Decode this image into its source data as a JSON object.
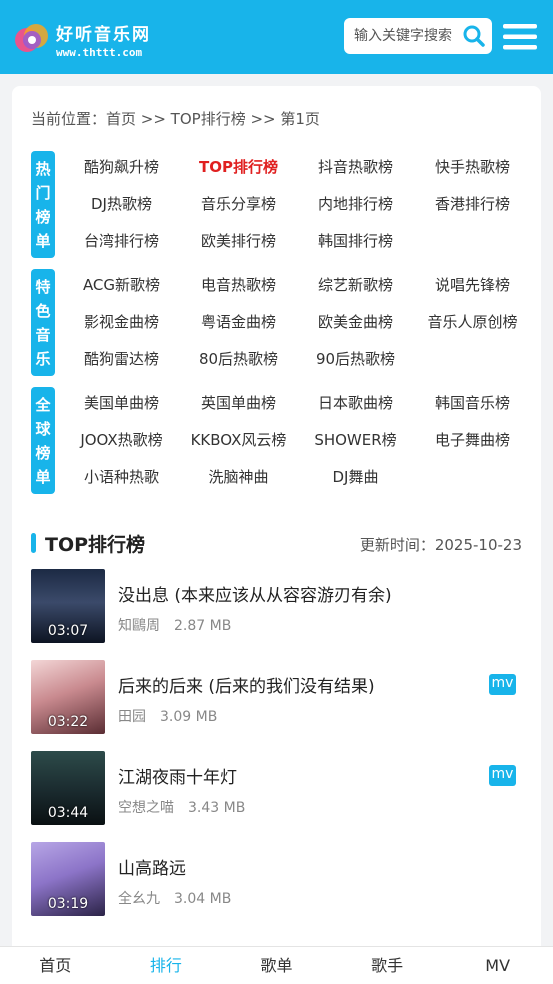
{
  "header": {
    "site_name": "好听音乐网",
    "site_url": "www.thttt.com",
    "search_placeholder": "输入关键字搜索",
    "accent_color": "#18b4ea"
  },
  "breadcrumb": "当前位置：首页 >> TOP排行榜 >> 第1页",
  "categories": [
    {
      "label": "热门榜单",
      "items": [
        "酷狗飙升榜",
        "TOP排行榜",
        "抖音热歌榜",
        "快手热歌榜",
        "DJ热歌榜",
        "音乐分享榜",
        "内地排行榜",
        "香港排行榜",
        "台湾排行榜",
        "欧美排行榜",
        "韩国排行榜"
      ]
    },
    {
      "label": "特色音乐",
      "items": [
        "ACG新歌榜",
        "电音热歌榜",
        "综艺新歌榜",
        "说唱先锋榜",
        "影视金曲榜",
        "粤语金曲榜",
        "欧美金曲榜",
        "音乐人原创榜",
        "酷狗雷达榜",
        "80后热歌榜",
        "90后热歌榜"
      ]
    },
    {
      "label": "全球榜单",
      "items": [
        "美国单曲榜",
        "英国单曲榜",
        "日本歌曲榜",
        "韩国音乐榜",
        "JOOX热歌榜",
        "KKBOX风云榜",
        "SHOWER榜",
        "电子舞曲榜",
        "小语种热歌",
        "洗脑神曲",
        "DJ舞曲"
      ]
    }
  ],
  "active_category": "TOP排行榜",
  "section": {
    "title": "TOP排行榜",
    "update_time": "更新时间：2025-10-23"
  },
  "songs": [
    {
      "title": "没出息 (本来应该从从容容游刃有余)",
      "artist": "知鷗周",
      "size": "2.87 MB",
      "duration": "03:07",
      "mv": false
    },
    {
      "title": "后来的后来 (后来的我们没有结果)",
      "artist": "田园",
      "size": "3.09 MB",
      "duration": "03:22",
      "mv": true,
      "mv_label": "mv"
    },
    {
      "title": "江湖夜雨十年灯",
      "artist": "空想之喵",
      "size": "3.43 MB",
      "duration": "03:44",
      "mv": true,
      "mv_label": "mv"
    },
    {
      "title": "山高路远",
      "artist": "全幺九",
      "size": "3.04 MB",
      "duration": "03:19",
      "mv": false
    }
  ],
  "bottom_nav": [
    "首页",
    "排行",
    "歌单",
    "歌手",
    "MV"
  ],
  "bottom_nav_active": "排行"
}
